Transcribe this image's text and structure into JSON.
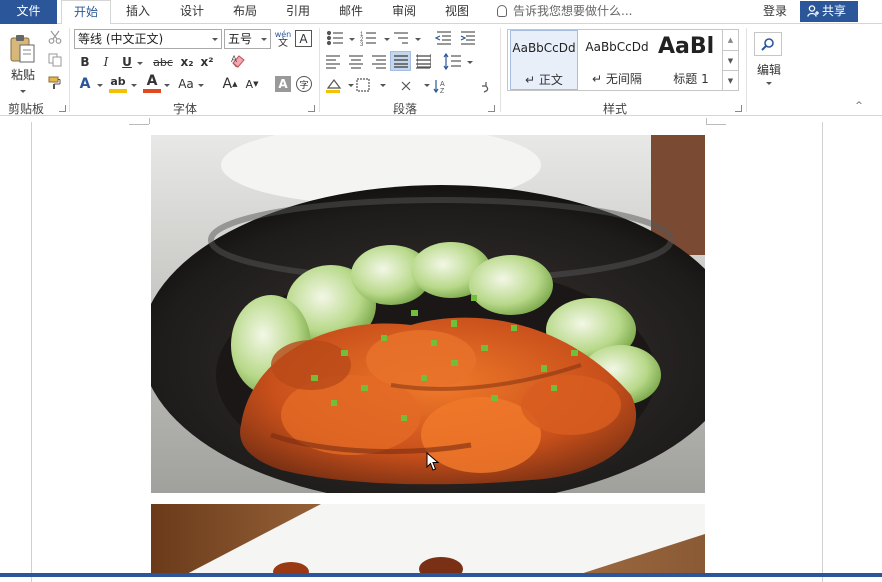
{
  "tabs": {
    "file": "文件",
    "home": "开始",
    "insert": "插入",
    "design": "设计",
    "layout": "布局",
    "references": "引用",
    "mailings": "邮件",
    "review": "审阅",
    "view": "视图"
  },
  "tell_me_placeholder": "告诉我您想要做什么...",
  "login": "登录",
  "share": "共享",
  "clipboard": {
    "paste": "粘贴",
    "group": "剪贴板"
  },
  "font": {
    "name": "等线 (中文正文)",
    "size": "五号",
    "wen": "wén",
    "wen_char": "文",
    "border_char": "A",
    "bold": "B",
    "italic": "I",
    "underline": "U",
    "strike": "abc",
    "sub": "x₂",
    "sup": "x²",
    "effects": "A",
    "highlight": "ab",
    "color": "A",
    "case": "Aa",
    "grow": "A",
    "shrink": "A",
    "shade": "A",
    "enclose": "字",
    "group": "字体"
  },
  "paragraph": {
    "group": "段落"
  },
  "styles": {
    "items": [
      {
        "sample": "AaBbCcDd",
        "name": "正文"
      },
      {
        "sample": "AaBbCcDd",
        "name": "无间隔"
      },
      {
        "sample": "AaBl",
        "name": "标题 1"
      }
    ],
    "group": "样式"
  },
  "editing": {
    "label": "编辑"
  },
  "colors": {
    "accent": "#2b579a",
    "highlight_bar": "#f2c200",
    "font_color_bar": "#e04a1c"
  }
}
